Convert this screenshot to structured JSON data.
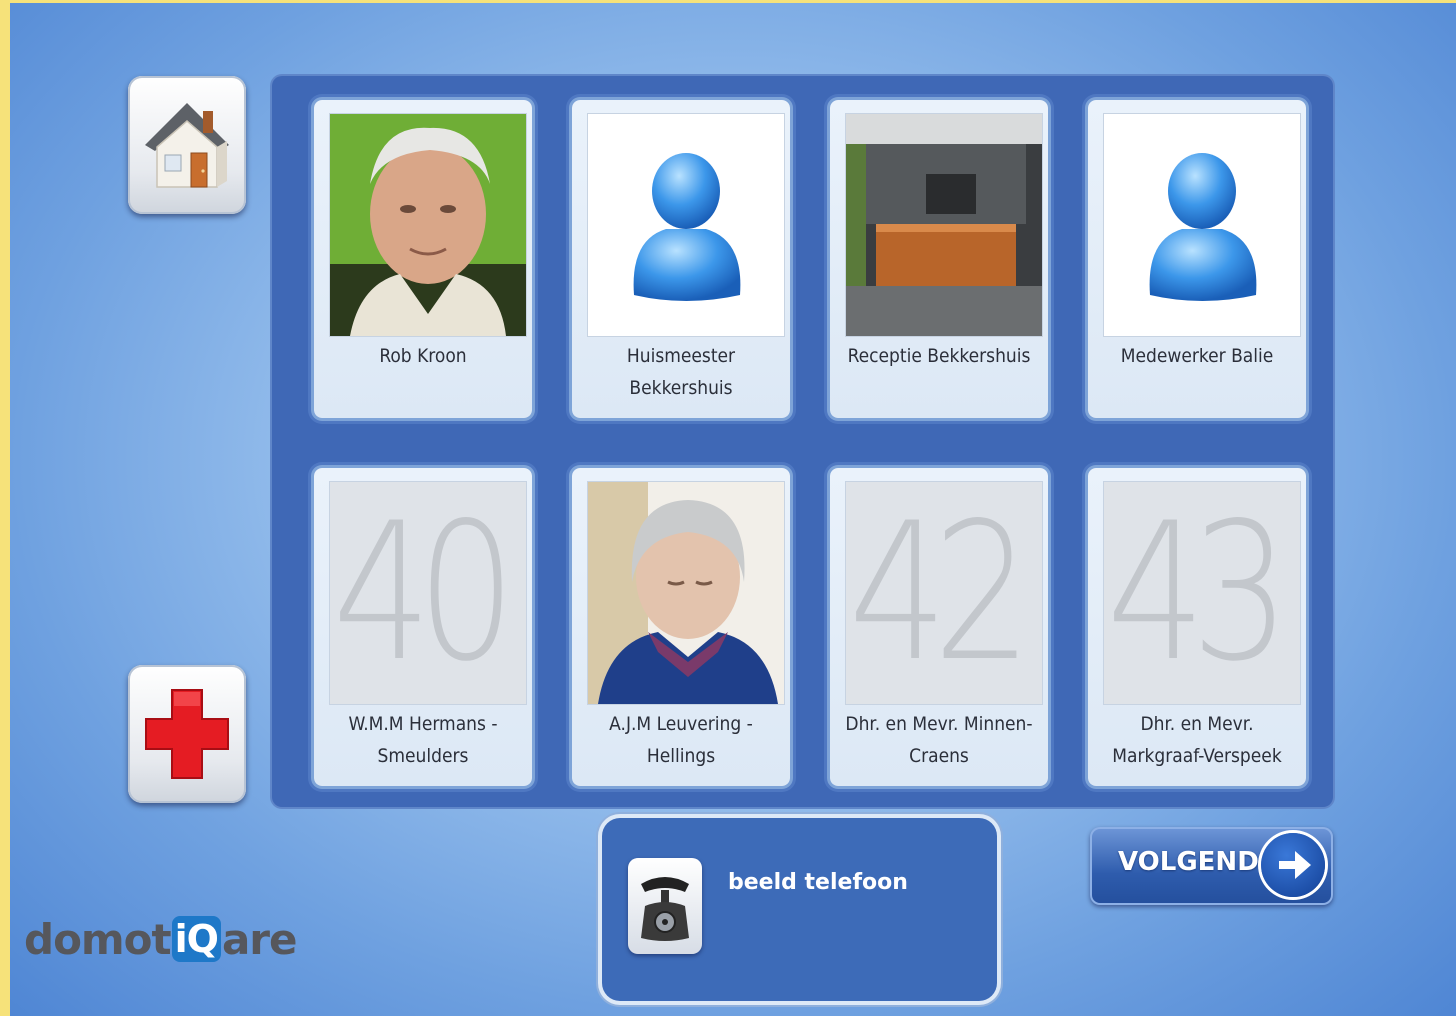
{
  "home_button": {
    "icon": "house-icon"
  },
  "emergency_button": {
    "icon": "red-cross-icon",
    "color": "#e51c23"
  },
  "contacts": [
    {
      "label": "Rob Kroon",
      "image": "photo-elderly-man"
    },
    {
      "label": "Huismeester Bekkershuis",
      "image": "generic-person-icon"
    },
    {
      "label": "Receptie Bekkershuis",
      "image": "photo-reception-desk"
    },
    {
      "label": "Medewerker Balie",
      "image": "generic-person-icon"
    },
    {
      "label": "W.M.M Hermans - Smeulders",
      "number": "40"
    },
    {
      "label": "A.J.M Leuvering - Hellings",
      "image": "photo-elderly-woman"
    },
    {
      "label": "Dhr. en Mevr. Minnen-Craens",
      "number": "42"
    },
    {
      "label": "Dhr. en Mevr. Markgraaf-Verspeek",
      "number": "43"
    }
  ],
  "video_phone": {
    "label": "beeld telefoon",
    "icon": "telephone-icon"
  },
  "next_button": {
    "label": "VOLGENDE",
    "icon": "arrow-right-icon"
  },
  "logo": {
    "part1": "domot",
    "part2": "iQ",
    "part3": "are"
  },
  "colors": {
    "panel": "#3f68b6",
    "background": "#9cc3ee",
    "accent": "#1e78c8"
  }
}
